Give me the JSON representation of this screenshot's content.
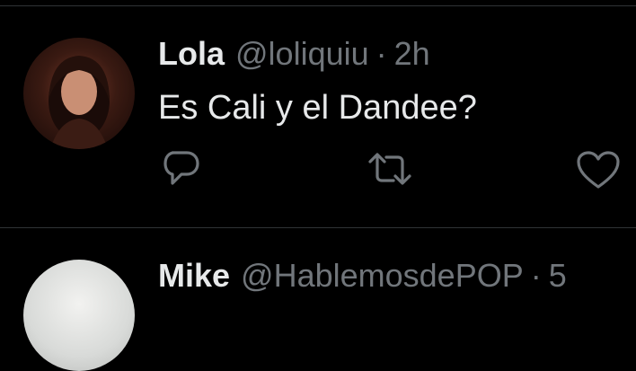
{
  "tweets": [
    {
      "name": "Lola",
      "handle": "@loliquiu",
      "separator": "·",
      "time": "2h",
      "text": "Es Cali y el Dandee?"
    },
    {
      "name": "Mike",
      "handle": "@HablemosdePOP",
      "separator": "·",
      "time": "5"
    }
  ],
  "actions": {
    "reply": "reply-icon",
    "retweet": "retweet-icon",
    "like": "heart-icon"
  },
  "colors": {
    "background": "#000000",
    "primary_text": "#e7e9ea",
    "secondary_text": "#71767b",
    "divider": "#2f3336"
  }
}
